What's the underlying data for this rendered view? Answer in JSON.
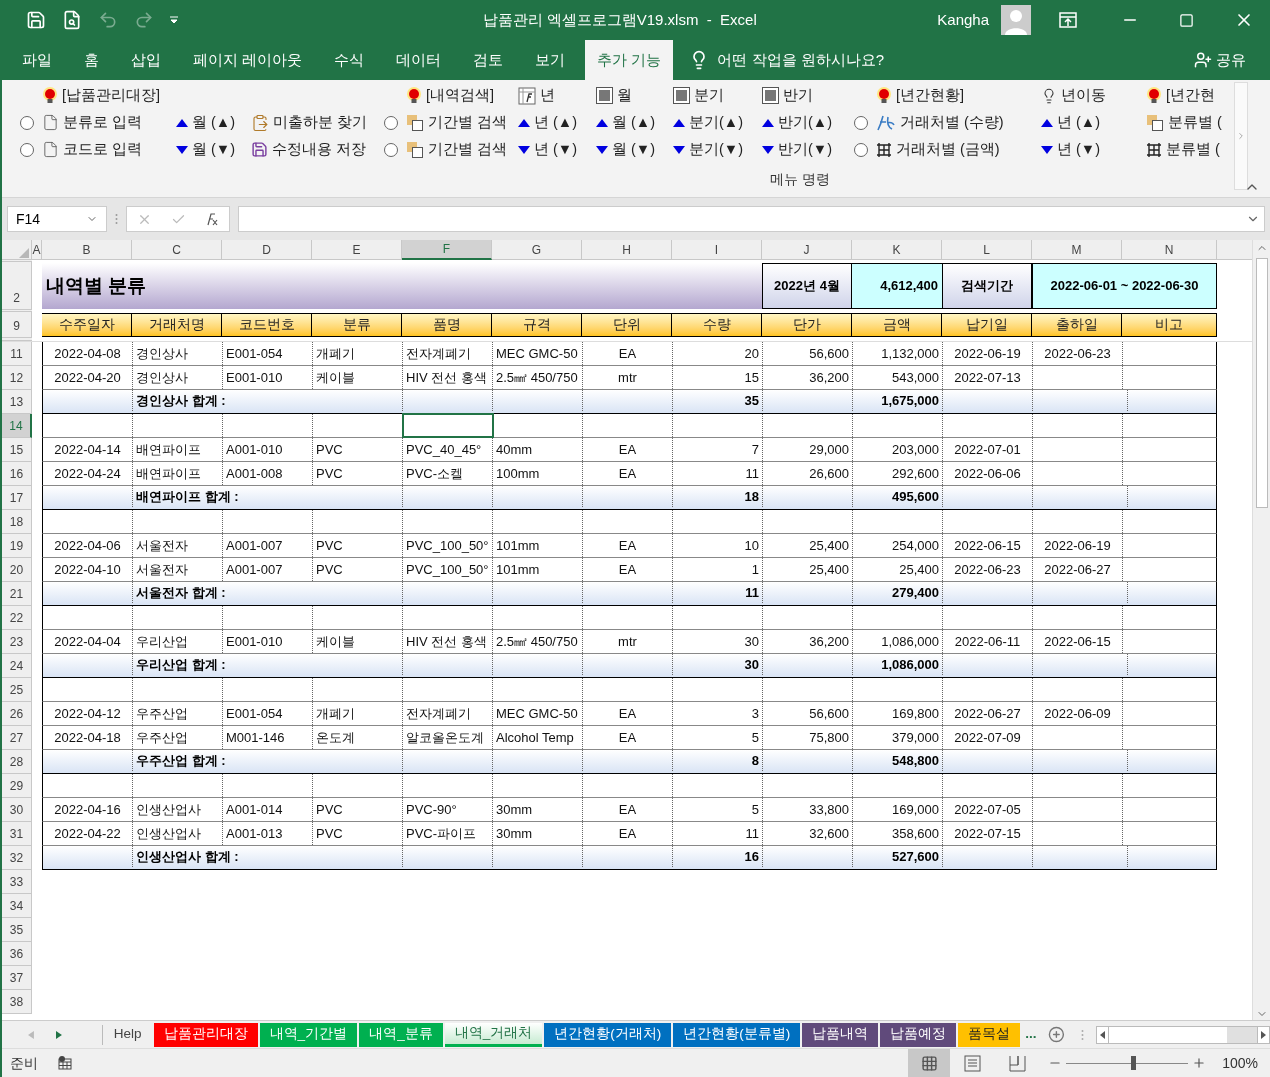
{
  "window": {
    "title": "납품관리 엑셀프로그램V19.xlsm  -  Excel",
    "user": "Kangha"
  },
  "menu_tabs": [
    {
      "label": "파일",
      "selected": false
    },
    {
      "label": "홈",
      "selected": false
    },
    {
      "label": "삽입",
      "selected": false
    },
    {
      "label": "페이지 레이아웃",
      "selected": false
    },
    {
      "label": "수식",
      "selected": false
    },
    {
      "label": "데이터",
      "selected": false
    },
    {
      "label": "검토",
      "selected": false
    },
    {
      "label": "보기",
      "selected": false
    },
    {
      "label": "추가 기능",
      "selected": true
    }
  ],
  "tell_me": {
    "placeholder": "어떤 작업을 원하시나요?"
  },
  "share": "공유",
  "ribbon": {
    "group_label": "메뉴 명령",
    "columns": [
      [
        {
          "kind": "redbulb",
          "label": "[납품관리대장]"
        },
        {
          "kind": "doc",
          "label": "분류로 입력",
          "selected": false
        },
        {
          "kind": "doc",
          "label": "코드로 입력",
          "selected": false
        }
      ],
      [
        {
          "kind": "none"
        },
        {
          "kind": "up",
          "label": "월 (▲)"
        },
        {
          "kind": "down",
          "label": "월 (▼)"
        }
      ],
      [
        {
          "kind": "none"
        },
        {
          "kind": "clipboard",
          "label": "미출하분 찾기"
        },
        {
          "kind": "save",
          "label": "수정내용 저장"
        }
      ],
      [
        {
          "kind": "redbulb",
          "label": "[내역검색]"
        },
        {
          "kind": "copy",
          "label": "기간별 검색",
          "selected": false
        },
        {
          "kind": "copy",
          "label": "기간별 검색",
          "selected": false
        }
      ],
      [
        {
          "kind": "formula",
          "label": "년"
        },
        {
          "kind": "up",
          "label": "년 (▲)"
        },
        {
          "kind": "down",
          "label": "년 (▼)"
        }
      ],
      [
        {
          "kind": "frame",
          "label": "월"
        },
        {
          "kind": "up",
          "label": "월 (▲)"
        },
        {
          "kind": "down",
          "label": "월 (▼)"
        }
      ],
      [
        {
          "kind": "frame",
          "label": "분기"
        },
        {
          "kind": "up",
          "label": "분기(▲)"
        },
        {
          "kind": "down",
          "label": "분기(▼)"
        }
      ],
      [
        {
          "kind": "frame",
          "label": "반기"
        },
        {
          "kind": "up",
          "label": "반기(▲)"
        },
        {
          "kind": "down",
          "label": "반기(▼)"
        }
      ],
      [
        {
          "kind": "redbulb",
          "label": "[년간현황]"
        },
        {
          "kind": "script",
          "label": "거래처별 (수량)",
          "selected": false
        },
        {
          "kind": "grid",
          "label": "거래처별 (금액)",
          "selected": false
        }
      ],
      [
        {
          "kind": "whitebulb",
          "label": "년이동"
        },
        {
          "kind": "up",
          "label": "년 (▲)"
        },
        {
          "kind": "down",
          "label": "년 (▼)"
        }
      ],
      [
        {
          "kind": "redbulb",
          "label": "[년간현"
        },
        {
          "kind": "copy",
          "label": "분류별 ("
        },
        {
          "kind": "grid",
          "label": "분류별 ("
        }
      ]
    ]
  },
  "name_box": "F14",
  "columns": [
    {
      "letter": "A",
      "selected": false
    },
    {
      "letter": "B",
      "selected": false
    },
    {
      "letter": "C",
      "selected": false
    },
    {
      "letter": "D",
      "selected": false
    },
    {
      "letter": "E",
      "selected": false
    },
    {
      "letter": "F",
      "selected": true
    },
    {
      "letter": "G",
      "selected": false
    },
    {
      "letter": "H",
      "selected": false
    },
    {
      "letter": "I",
      "selected": false
    },
    {
      "letter": "J",
      "selected": false
    },
    {
      "letter": "K",
      "selected": false
    },
    {
      "letter": "L",
      "selected": false
    },
    {
      "letter": "M",
      "selected": false
    },
    {
      "letter": "N",
      "selected": false
    }
  ],
  "banner": {
    "row": "2",
    "title": "내역별 분류",
    "month": "2022년 4월",
    "total": "4,612,400",
    "period_label": "검색기간",
    "period": "2022-06-01 ~ 2022-06-30"
  },
  "header_row": {
    "row": "9",
    "labels": [
      "수주일자",
      "거래처명",
      "코드번호",
      "분류",
      "품명",
      "규격",
      "단위",
      "수량",
      "단가",
      "금액",
      "납기일",
      "출하일",
      "비고"
    ]
  },
  "rows": [
    {
      "row": "11",
      "kind": "item",
      "selected": false,
      "date": "2022-04-08",
      "vendor": "경인상사",
      "code": "E001-054",
      "category": "개폐기",
      "item": "전자계폐기",
      "spec": "MEC GMC-50",
      "unit": "EA",
      "qty": "20",
      "price": "56,600",
      "amount": "1,132,000",
      "due": "2022-06-19",
      "shipped": "2022-06-23"
    },
    {
      "row": "12",
      "kind": "item",
      "selected": false,
      "date": "2022-04-20",
      "vendor": "경인상사",
      "code": "E001-010",
      "category": "케이블",
      "item": "HIV  전선 홍색",
      "spec": "2.5㎟ 450/750",
      "unit": "mtr",
      "qty": "15",
      "price": "36,200",
      "amount": "543,000",
      "due": "2022-07-13"
    },
    {
      "row": "13",
      "kind": "subtotal",
      "selected": false,
      "label": "경인상사 합계  :",
      "qty": "35",
      "amount": "1,675,000"
    },
    {
      "row": "14",
      "kind": "blank",
      "selected": true
    },
    {
      "row": "15",
      "kind": "item",
      "selected": false,
      "date": "2022-04-14",
      "vendor": "배연파이프",
      "code": "A001-010",
      "category": "PVC",
      "item": "PVC_40_45°",
      "spec": "40mm",
      "unit": "EA",
      "qty": "7",
      "price": "29,000",
      "amount": "203,000",
      "due": "2022-07-01"
    },
    {
      "row": "16",
      "kind": "item",
      "selected": false,
      "date": "2022-04-24",
      "vendor": "배연파이프",
      "code": "A001-008",
      "category": "PVC",
      "item": "PVC-소켈",
      "spec": "100mm",
      "unit": "EA",
      "qty": "11",
      "price": "26,600",
      "amount": "292,600",
      "due": "2022-06-06"
    },
    {
      "row": "17",
      "kind": "subtotal",
      "selected": false,
      "label": "배연파이프 합계  :",
      "qty": "18",
      "amount": "495,600"
    },
    {
      "row": "18",
      "kind": "blank",
      "selected": false
    },
    {
      "row": "19",
      "kind": "item",
      "selected": false,
      "date": "2022-04-06",
      "vendor": "서울전자",
      "code": "A001-007",
      "category": "PVC",
      "item": "PVC_100_50°",
      "spec": "101mm",
      "unit": "EA",
      "qty": "10",
      "price": "25,400",
      "amount": "254,000",
      "due": "2022-06-15",
      "shipped": "2022-06-19"
    },
    {
      "row": "20",
      "kind": "item",
      "selected": false,
      "date": "2022-04-10",
      "vendor": "서울전자",
      "code": "A001-007",
      "category": "PVC",
      "item": "PVC_100_50°",
      "spec": "101mm",
      "unit": "EA",
      "qty": "1",
      "price": "25,400",
      "amount": "25,400",
      "due": "2022-06-23",
      "shipped": "2022-06-27"
    },
    {
      "row": "21",
      "kind": "subtotal",
      "selected": false,
      "label": "서울전자 합계  :",
      "qty": "11",
      "amount": "279,400"
    },
    {
      "row": "22",
      "kind": "blank",
      "selected": false
    },
    {
      "row": "23",
      "kind": "item",
      "selected": false,
      "date": "2022-04-04",
      "vendor": "우리산업",
      "code": "E001-010",
      "category": "케이블",
      "item": "HIV  전선 홍색",
      "spec": "2.5㎟ 450/750",
      "unit": "mtr",
      "qty": "30",
      "price": "36,200",
      "amount": "1,086,000",
      "due": "2022-06-11",
      "shipped": "2022-06-15"
    },
    {
      "row": "24",
      "kind": "subtotal",
      "selected": false,
      "label": "우리산업 합계  :",
      "qty": "30",
      "amount": "1,086,000"
    },
    {
      "row": "25",
      "kind": "blank",
      "selected": false
    },
    {
      "row": "26",
      "kind": "item",
      "selected": false,
      "date": "2022-04-12",
      "vendor": "우주산업",
      "code": "E001-054",
      "category": "개폐기",
      "item": "전자계폐기",
      "spec": "MEC GMC-50",
      "unit": "EA",
      "qty": "3",
      "price": "56,600",
      "amount": "169,800",
      "due": "2022-06-27",
      "shipped": "2022-06-09"
    },
    {
      "row": "27",
      "kind": "item",
      "selected": false,
      "date": "2022-04-18",
      "vendor": "우주산업",
      "code": "M001-146",
      "category": "온도계",
      "item": "알코올온도계",
      "spec": "Alcohol Temp",
      "unit": "EA",
      "qty": "5",
      "price": "75,800",
      "amount": "379,000",
      "due": "2022-07-09"
    },
    {
      "row": "28",
      "kind": "subtotal",
      "selected": false,
      "label": "우주산업 합계  :",
      "qty": "8",
      "amount": "548,800"
    },
    {
      "row": "29",
      "kind": "blank",
      "selected": false
    },
    {
      "row": "30",
      "kind": "item",
      "selected": false,
      "date": "2022-04-16",
      "vendor": "인생산업사",
      "code": "A001-014",
      "category": "PVC",
      "item": "PVC-90°",
      "spec": "30mm",
      "unit": "EA",
      "qty": "5",
      "price": "33,800",
      "amount": "169,000",
      "due": "2022-07-05"
    },
    {
      "row": "31",
      "kind": "item",
      "selected": false,
      "date": "2022-04-22",
      "vendor": "인생산업사",
      "code": "A001-013",
      "category": "PVC",
      "item": "PVC-파이프",
      "spec": "30mm",
      "unit": "EA",
      "qty": "11",
      "price": "32,600",
      "amount": "358,600",
      "due": "2022-07-15"
    },
    {
      "row": "32",
      "kind": "subtotal",
      "selected": false,
      "label": "인생산업사 합계  :",
      "qty": "16",
      "amount": "527,600"
    },
    {
      "row": "33",
      "kind": "empty",
      "selected": false
    },
    {
      "row": "34",
      "kind": "empty",
      "selected": false
    },
    {
      "row": "35",
      "kind": "empty",
      "selected": false
    },
    {
      "row": "36",
      "kind": "empty",
      "selected": false
    },
    {
      "row": "37",
      "kind": "empty",
      "selected": false
    },
    {
      "row": "38",
      "kind": "empty",
      "selected": false
    }
  ],
  "sheet_tabs": [
    {
      "label": "Help",
      "selected": false
    },
    {
      "label": "납품관리대장",
      "color": "#ff0000",
      "selected": false
    },
    {
      "label": "내역_기간별",
      "color": "#00b050",
      "selected": false
    },
    {
      "label": "내역_분류",
      "color": "#00b050",
      "selected": false
    },
    {
      "label": "내역_거래처",
      "color": "#00b050",
      "selected": true
    },
    {
      "label": "년간현황(거래처)",
      "color": "#0070c0",
      "selected": false
    },
    {
      "label": "년간현황(분류별)",
      "color": "#0070c0",
      "selected": false
    },
    {
      "label": "납품내역",
      "color": "#604a7b",
      "selected": false
    },
    {
      "label": "납품예정",
      "color": "#604a7b",
      "selected": false
    },
    {
      "label": "품목설",
      "color": "#ffc000",
      "selected": false
    }
  ],
  "more_tabs": "...",
  "status_bar": {
    "state": "준비",
    "zoom": {
      "level": 0.55,
      "reading": "100%"
    }
  }
}
